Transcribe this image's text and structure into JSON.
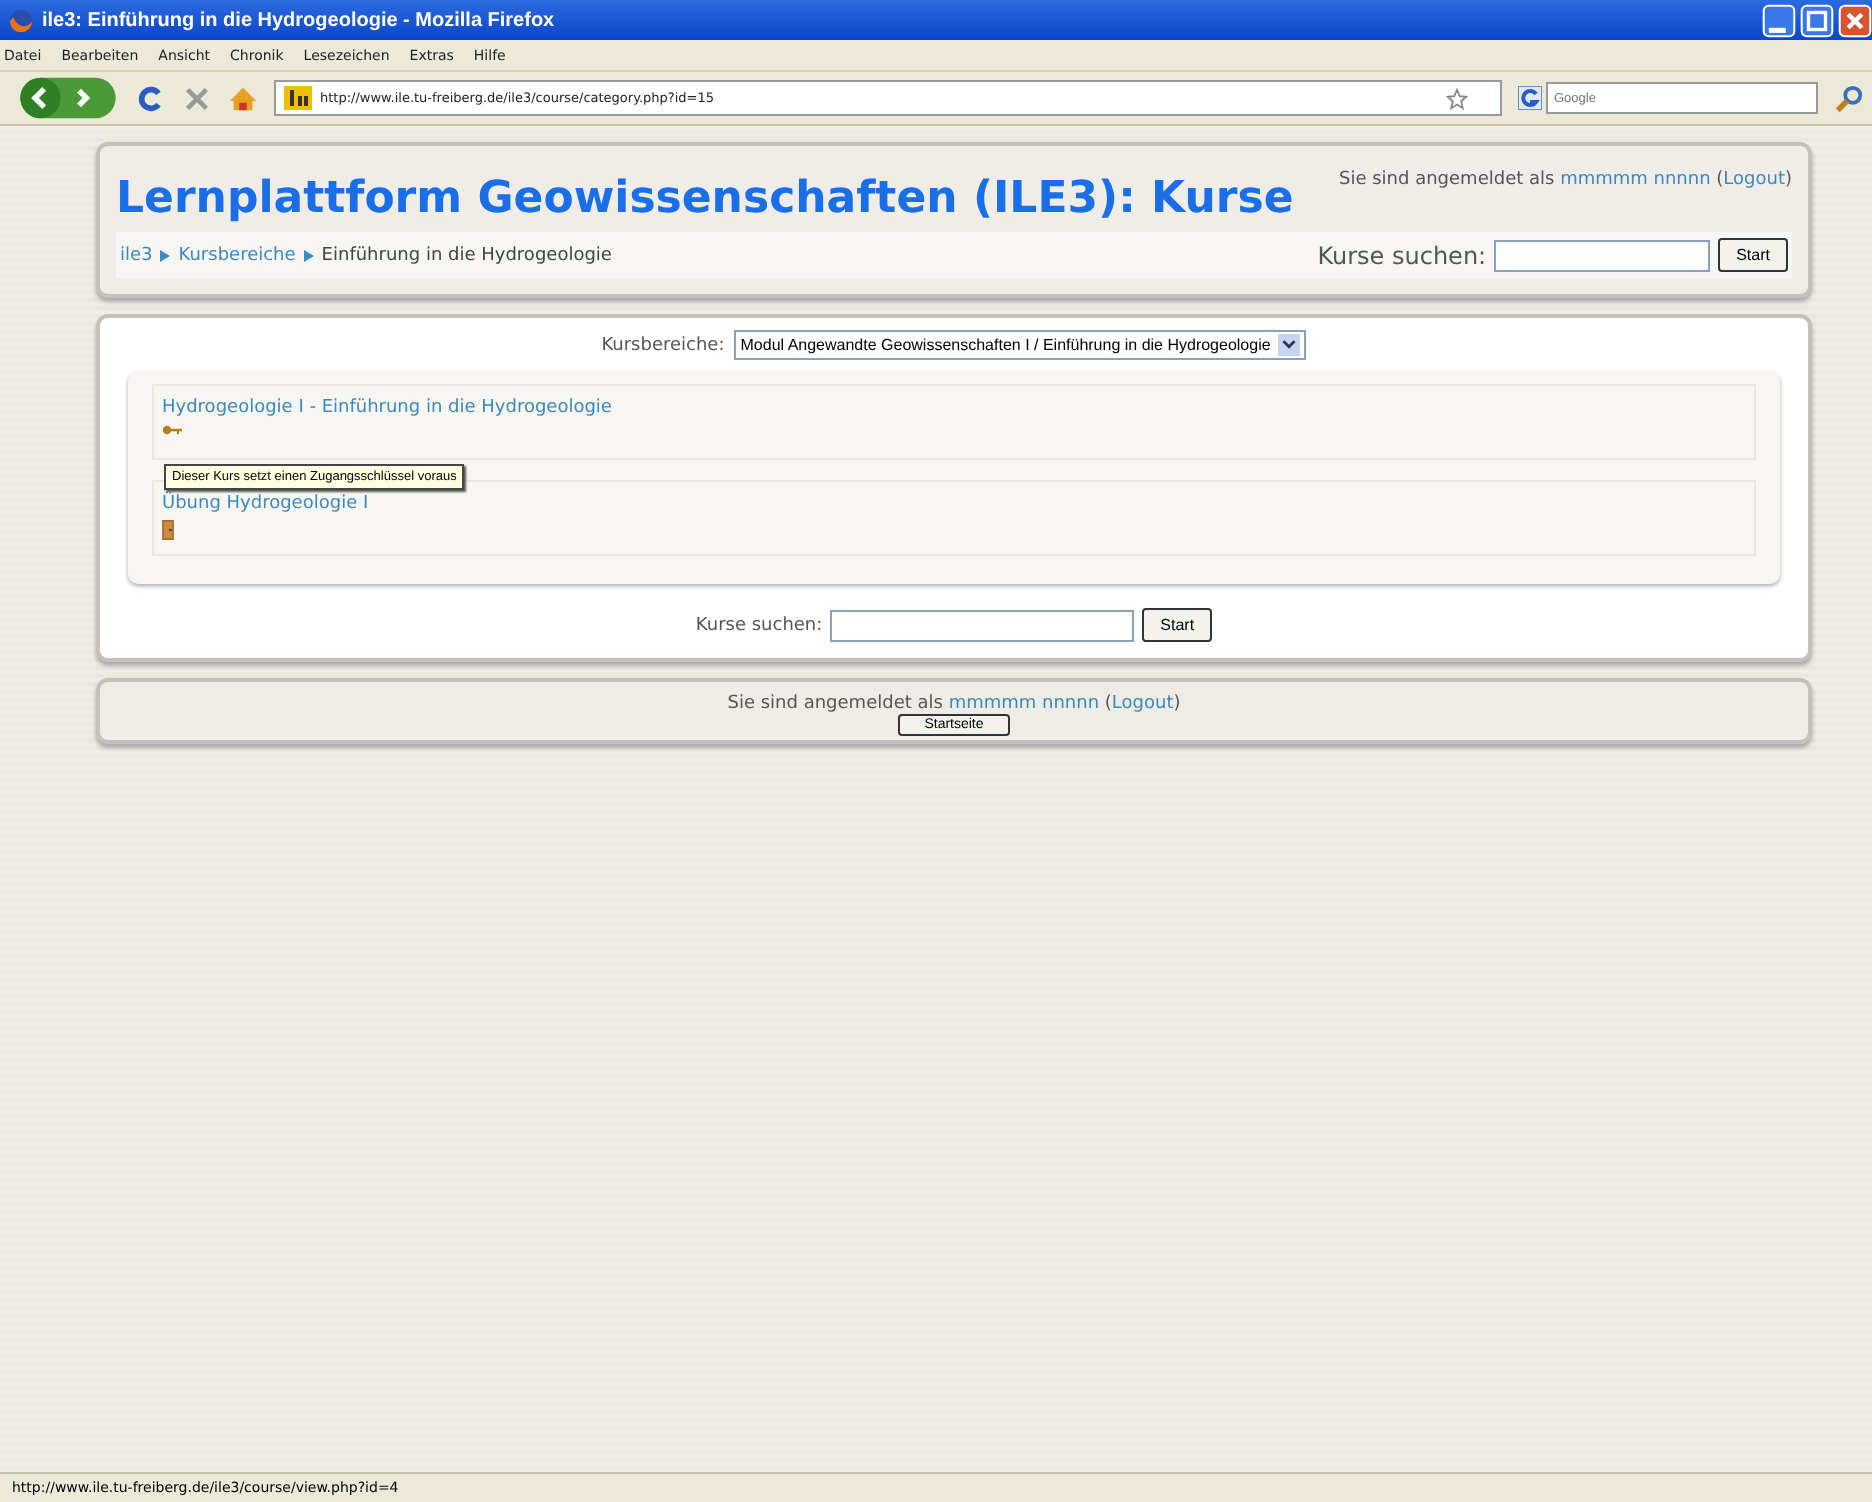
{
  "window": {
    "title": "ile3: Einführung in die Hydrogeologie - Mozilla Firefox"
  },
  "menu": [
    "Datei",
    "Bearbeiten",
    "Ansicht",
    "Chronik",
    "Lesezeichen",
    "Extras",
    "Hilfe"
  ],
  "toolbar": {
    "url": "http://www.ile.tu-freiberg.de/ile3/course/category.php?id=15",
    "search_placeholder": "Google"
  },
  "header": {
    "title": "Lernplattform Geowissenschaften (ILE3): Kurse",
    "login": [
      {
        "kind": "text",
        "text": "Sie sind angemeldet als "
      },
      {
        "kind": "link",
        "text": "mmmmm nnnnn"
      },
      {
        "kind": "text",
        "text": " ("
      },
      {
        "kind": "link",
        "text": "Logout"
      },
      {
        "kind": "text",
        "text": ")"
      }
    ],
    "breadcrumb": [
      {
        "kind": "link",
        "text": "ile3"
      },
      {
        "kind": "link",
        "text": "Kursbereiche"
      },
      {
        "kind": "text",
        "text": "Einführung in die Hydrogeologie"
      }
    ],
    "search": {
      "label": "Kurse suchen:",
      "button": "Start"
    }
  },
  "category": {
    "label": "Kursbereiche:",
    "value": "Modul Angewandte Geowissenschaften I / Einführung in die Hydrogeologie"
  },
  "courses": [
    {
      "name": "Hydrogeologie I - Einführung in die Hydrogeologie",
      "kind": "key"
    },
    {
      "name": "Übung Hydrogeologie I",
      "kind": "door"
    }
  ],
  "tooltip": "Dieser Kurs setzt einen Zugangsschlüssel voraus",
  "search": {
    "label": "Kurse suchen:",
    "button": "Start"
  },
  "footer": {
    "login": [
      {
        "kind": "text",
        "text": "Sie sind angemeldet als "
      },
      {
        "kind": "link",
        "text": "mmmmm nnnnn"
      },
      {
        "kind": "text",
        "text": " ("
      },
      {
        "kind": "link",
        "text": "Logout"
      },
      {
        "kind": "text",
        "text": ")"
      }
    ],
    "button": "Startseite"
  },
  "status_bar": "http://www.ile.tu-freiberg.de/ile3/course/view.php?id=4"
}
